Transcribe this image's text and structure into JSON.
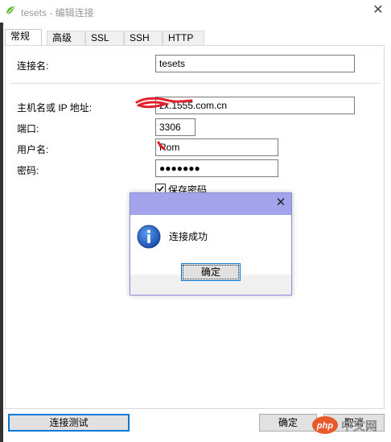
{
  "window": {
    "title": "tesets - 编辑连接",
    "close_icon": "close-icon"
  },
  "tabs": [
    {
      "label": "常规",
      "active": true
    },
    {
      "label": "高级",
      "active": false
    },
    {
      "label": "SSL",
      "active": false
    },
    {
      "label": "SSH",
      "active": false
    },
    {
      "label": "HTTP",
      "active": false
    }
  ],
  "form": {
    "connection_name": {
      "label": "连接名:",
      "value": "tesets"
    },
    "host": {
      "label": "主机名或 IP 地址:",
      "value": "zx.1555.com.cn"
    },
    "port": {
      "label": "端口:",
      "value": "3306"
    },
    "username": {
      "label": "用户名:",
      "value": "Rom"
    },
    "password": {
      "label": "密码:",
      "value": "●●●●●●●"
    },
    "save_password": {
      "label": "保存密码",
      "checked": true
    }
  },
  "dialog": {
    "message": "连接成功",
    "ok_label": "确定",
    "icon": "info-icon"
  },
  "footer": {
    "test_label": "连接测试",
    "ok_label": "确定",
    "cancel_label": "取消"
  },
  "watermark": {
    "text": "php 中文网"
  },
  "colors": {
    "dialog_title_bar": "#a3a3ec",
    "focus_border": "#0078d7",
    "annotation_red": "#e0202a"
  }
}
